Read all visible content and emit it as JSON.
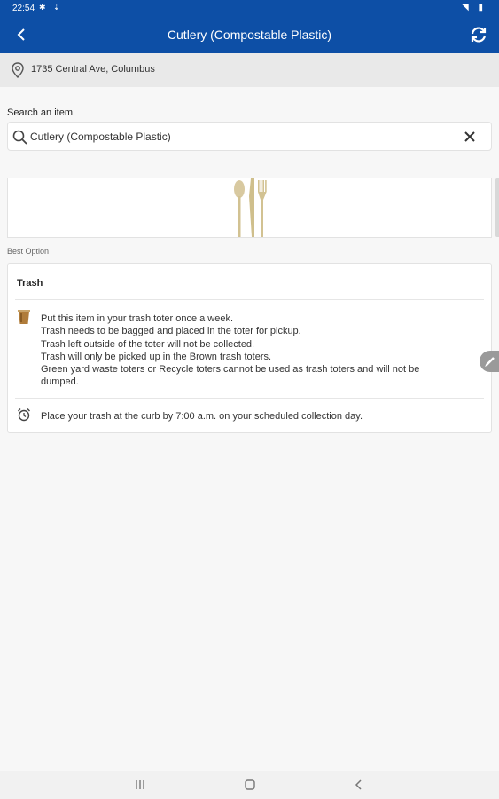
{
  "status_bar": {
    "time": "22:54"
  },
  "app_bar": {
    "title": "Cutlery (Compostable Plastic)"
  },
  "location": {
    "address": "1735 Central Ave, Columbus"
  },
  "search": {
    "label": "Search an item",
    "value": "Cutlery (Compostable Plastic)"
  },
  "result": {
    "section_label": "Best Option",
    "card_title": "Trash",
    "instructions": [
      "Put this item in your trash toter once a week.",
      "Trash needs to be bagged and placed in the toter for pickup.",
      "Trash left outside of the toter will not be collected.",
      "Trash will only be picked up in the Brown trash toters.",
      "Green yard waste toters or Recycle toters cannot be used as trash toters and will not be",
      "dumped."
    ],
    "timing": "Place your trash at the curb by 7:00 a.m. on your scheduled collection day."
  },
  "icons": {
    "back": "back-arrow-icon",
    "refresh": "refresh-icon",
    "location": "location-pin-icon",
    "search": "search-icon",
    "clear": "close-icon",
    "bin": "trash-bin-icon",
    "clock": "alarm-clock-icon",
    "edit": "pencil-icon"
  },
  "colors": {
    "primary": "#0d4fa6",
    "background": "#f7f7f7"
  }
}
